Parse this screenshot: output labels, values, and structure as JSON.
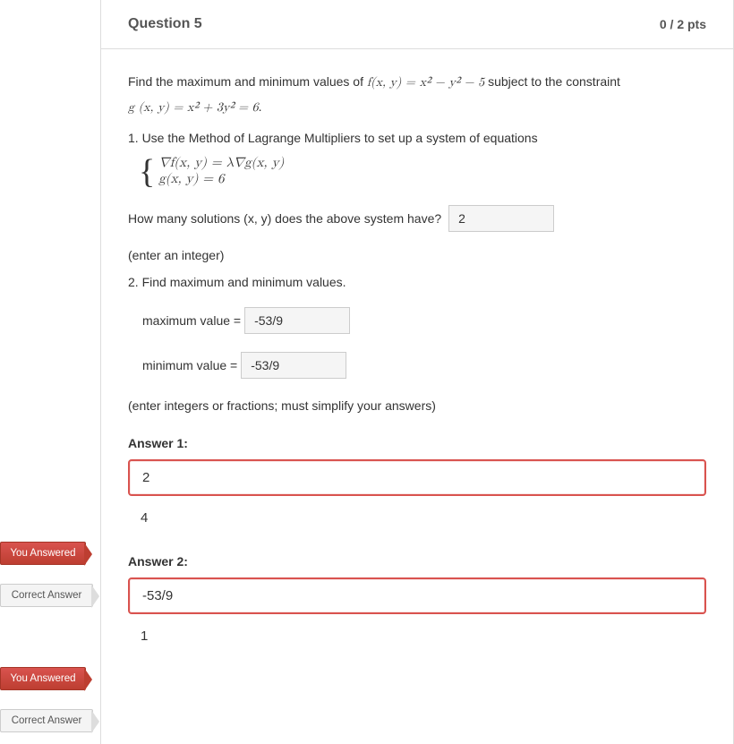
{
  "header": {
    "title": "Question 5",
    "pts": "0 / 2 pts"
  },
  "prompt": {
    "intro_a": "Find the maximum and minimum values of ",
    "f_expr": "f(x, y) = x² − y² − 5",
    "intro_b": " subject to the constraint ",
    "g_expr": "g (x, y) = x² + 3y² = 6",
    "period": "."
  },
  "step1": {
    "text": "1.  Use the Method of Lagrange Multipliers to set up a system of equations",
    "sys_line1": "∇f(x, y) = λ∇g(x, y)",
    "sys_line2": "g(x, y) = 6",
    "ask": "How many solutions (x, y) does the above system have?",
    "input": "2",
    "note": "(enter an integer)"
  },
  "step2": {
    "text": "2.  Find maximum and minimum values.",
    "max_label": "maximum value =",
    "max_input": "-53/9",
    "min_label": "minimum value =",
    "min_input": "-53/9",
    "hint": "(enter integers or fractions; must simplify your answers)"
  },
  "tags": {
    "you": "You Answered",
    "correct": "Correct Answer"
  },
  "answers": {
    "a1_label": "Answer 1:",
    "a1_you": "2",
    "a1_correct": "4",
    "a2_label": "Answer 2:",
    "a2_you": "-53/9",
    "a2_correct": "1"
  }
}
